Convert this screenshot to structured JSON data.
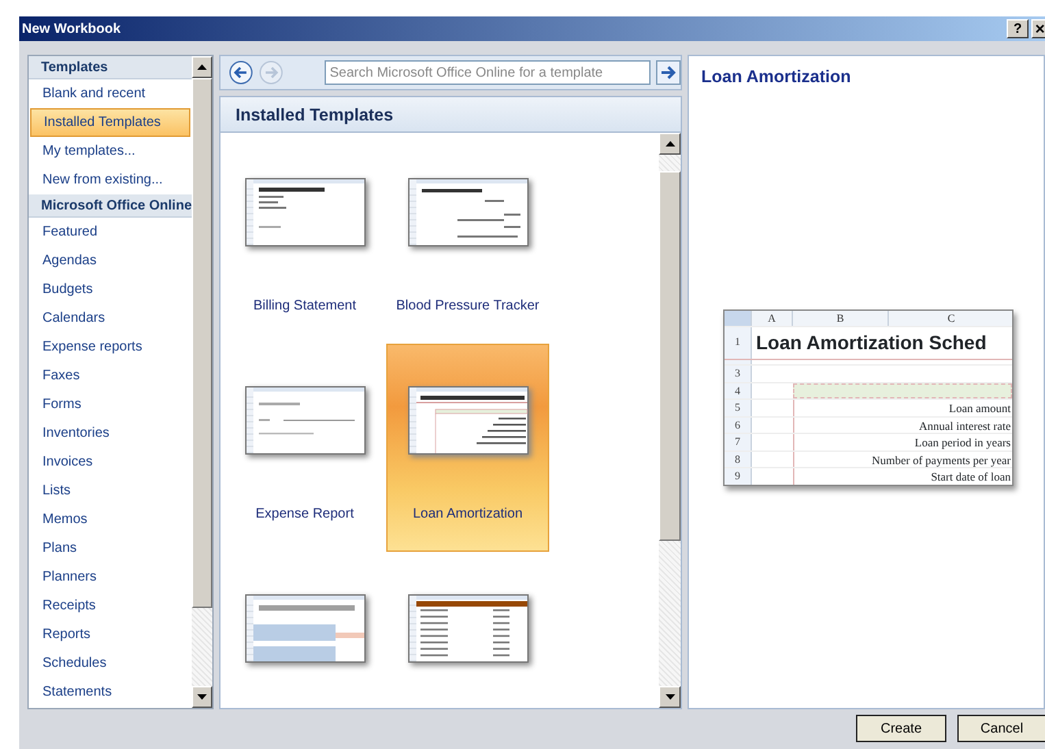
{
  "window": {
    "title": "New Workbook",
    "help": "?"
  },
  "sidebar": {
    "items": [
      {
        "kind": "header",
        "label": "Templates"
      },
      {
        "kind": "item",
        "label": "Blank and recent",
        "selected": false
      },
      {
        "kind": "item",
        "label": "Installed Templates",
        "selected": true
      },
      {
        "kind": "item",
        "label": "My templates...",
        "selected": false
      },
      {
        "kind": "item",
        "label": "New from existing...",
        "selected": false
      },
      {
        "kind": "header",
        "label": "Microsoft Office Online"
      },
      {
        "kind": "item",
        "label": "Featured",
        "selected": false
      },
      {
        "kind": "item",
        "label": "Agendas",
        "selected": false
      },
      {
        "kind": "item",
        "label": "Budgets",
        "selected": false
      },
      {
        "kind": "item",
        "label": "Calendars",
        "selected": false
      },
      {
        "kind": "item",
        "label": "Expense reports",
        "selected": false
      },
      {
        "kind": "item",
        "label": "Faxes",
        "selected": false
      },
      {
        "kind": "item",
        "label": "Forms",
        "selected": false
      },
      {
        "kind": "item",
        "label": "Inventories",
        "selected": false
      },
      {
        "kind": "item",
        "label": "Invoices",
        "selected": false
      },
      {
        "kind": "item",
        "label": "Lists",
        "selected": false
      },
      {
        "kind": "item",
        "label": "Memos",
        "selected": false
      },
      {
        "kind": "item",
        "label": "Plans",
        "selected": false
      },
      {
        "kind": "item",
        "label": "Planners",
        "selected": false
      },
      {
        "kind": "item",
        "label": "Receipts",
        "selected": false
      },
      {
        "kind": "item",
        "label": "Reports",
        "selected": false
      },
      {
        "kind": "item",
        "label": "Schedules",
        "selected": false
      },
      {
        "kind": "item",
        "label": "Statements",
        "selected": false
      }
    ]
  },
  "toolbar": {
    "back": {
      "disabled": false
    },
    "forward": {
      "disabled": true
    },
    "search": {
      "placeholder": "Search Microsoft Office Online for a template"
    }
  },
  "gallery": {
    "title": "Installed Templates",
    "templates": [
      {
        "kind": "billing",
        "label": "Billing Statement",
        "selected": false
      },
      {
        "kind": "tracker",
        "label": "Blood Pressure Tracker",
        "selected": false
      },
      {
        "kind": "expense",
        "label": "Expense Report",
        "selected": false
      },
      {
        "kind": "loan",
        "label": "Loan Amortization",
        "selected": true
      },
      {
        "kind": "budget",
        "selected": false
      },
      {
        "kind": "list",
        "selected": false
      }
    ]
  },
  "preview": {
    "title": "Loan Amortization",
    "columns": [
      "A",
      "B",
      "C"
    ],
    "heading_row": "1",
    "heading": "Loan Amortization Sched",
    "rows": [
      {
        "num": "3",
        "kind": "blank"
      },
      {
        "num": "4",
        "kind": "band"
      },
      {
        "num": "5",
        "kind": "field",
        "label": "Loan amount"
      },
      {
        "num": "6",
        "kind": "field",
        "label": "Annual interest rate"
      },
      {
        "num": "7",
        "kind": "field",
        "label": "Loan period in years"
      },
      {
        "num": "8",
        "kind": "field",
        "label": "Number of payments per year"
      },
      {
        "num": "9",
        "kind": "field",
        "label": "Start date of loan"
      }
    ]
  },
  "buttons": [
    {
      "label": "Create"
    },
    {
      "label": "Cancel"
    }
  ]
}
